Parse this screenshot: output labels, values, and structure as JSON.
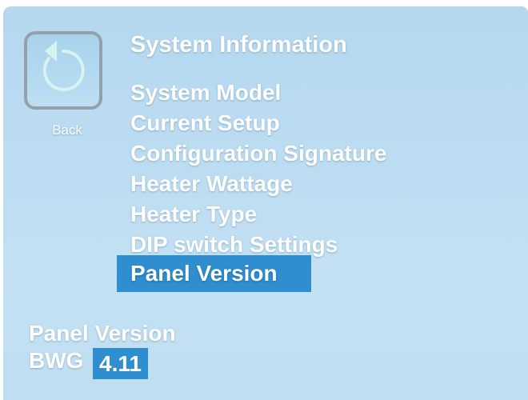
{
  "back_button": {
    "label": "Back",
    "icon": "undo-arrow-icon"
  },
  "menu": {
    "title": "System Information",
    "items": [
      {
        "label": "System Model"
      },
      {
        "label": "Current Setup"
      },
      {
        "label": "Configuration Signature"
      },
      {
        "label": "Heater Wattage"
      },
      {
        "label": "Heater Type"
      },
      {
        "label": "DIP switch Settings"
      },
      {
        "label": "Panel Version",
        "selected": true
      }
    ]
  },
  "detail": {
    "label": "Panel Version",
    "prefix": "BWG",
    "version": "4.11"
  },
  "colors": {
    "background": "#bcdcf1",
    "highlight": "#2f8ecf",
    "text": "#ffffff",
    "button_border": "#92a1ac"
  }
}
